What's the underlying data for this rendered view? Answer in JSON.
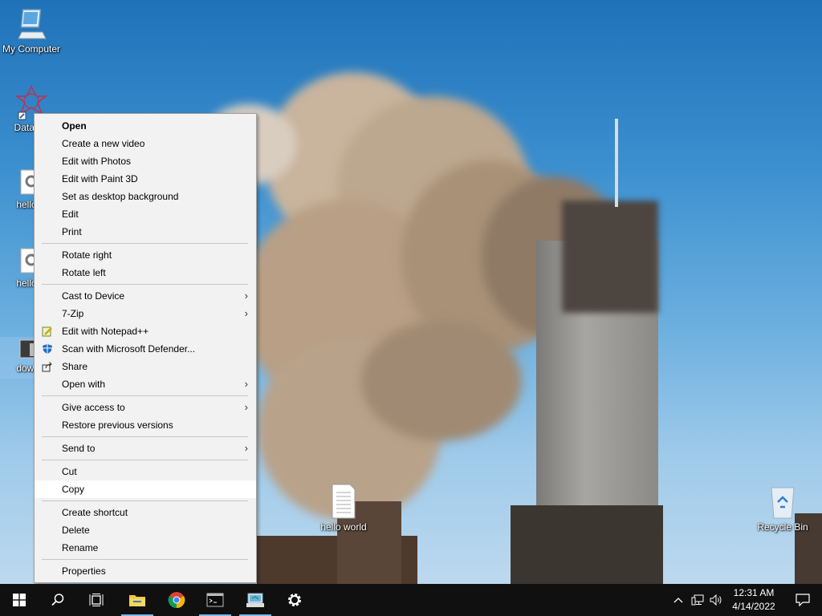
{
  "desktop": {
    "icons": [
      {
        "label": "My Computer"
      },
      {
        "label": "DataWa"
      },
      {
        "label": "hello w"
      },
      {
        "label": "hello w"
      },
      {
        "label": "downlc"
      },
      {
        "label": "hello world"
      },
      {
        "label": "Recycle Bin"
      }
    ]
  },
  "context_menu": {
    "items": [
      {
        "label": "Open"
      },
      {
        "label": "Create a new video"
      },
      {
        "label": "Edit with Photos"
      },
      {
        "label": "Edit with Paint 3D"
      },
      {
        "label": "Set as desktop background"
      },
      {
        "label": "Edit"
      },
      {
        "label": "Print"
      },
      {
        "label": "Rotate right"
      },
      {
        "label": "Rotate left"
      },
      {
        "label": "Cast to Device"
      },
      {
        "label": "7-Zip"
      },
      {
        "label": "Edit with Notepad++"
      },
      {
        "label": "Scan with Microsoft Defender..."
      },
      {
        "label": "Share"
      },
      {
        "label": "Open with"
      },
      {
        "label": "Give access to"
      },
      {
        "label": "Restore previous versions"
      },
      {
        "label": "Send to"
      },
      {
        "label": "Cut"
      },
      {
        "label": "Copy"
      },
      {
        "label": "Create shortcut"
      },
      {
        "label": "Delete"
      },
      {
        "label": "Rename"
      },
      {
        "label": "Properties"
      }
    ],
    "submenu_glyph": "›",
    "highlighted": "Copy"
  },
  "taskbar": {
    "buttons": [
      "windows-start-icon",
      "search-icon",
      "task-view-icon",
      "file-explorer-icon",
      "chrome-icon",
      "terminal-icon",
      "control-panel-icon",
      "settings-icon"
    ],
    "tray": {
      "chevron": "^",
      "time": "12:31 AM",
      "date": "4/14/2022"
    }
  },
  "colors": {
    "taskbar": "#101010",
    "menu_bg": "#f2f2f2",
    "menu_hover": "#ffffff",
    "accent": "#76b9ed"
  }
}
